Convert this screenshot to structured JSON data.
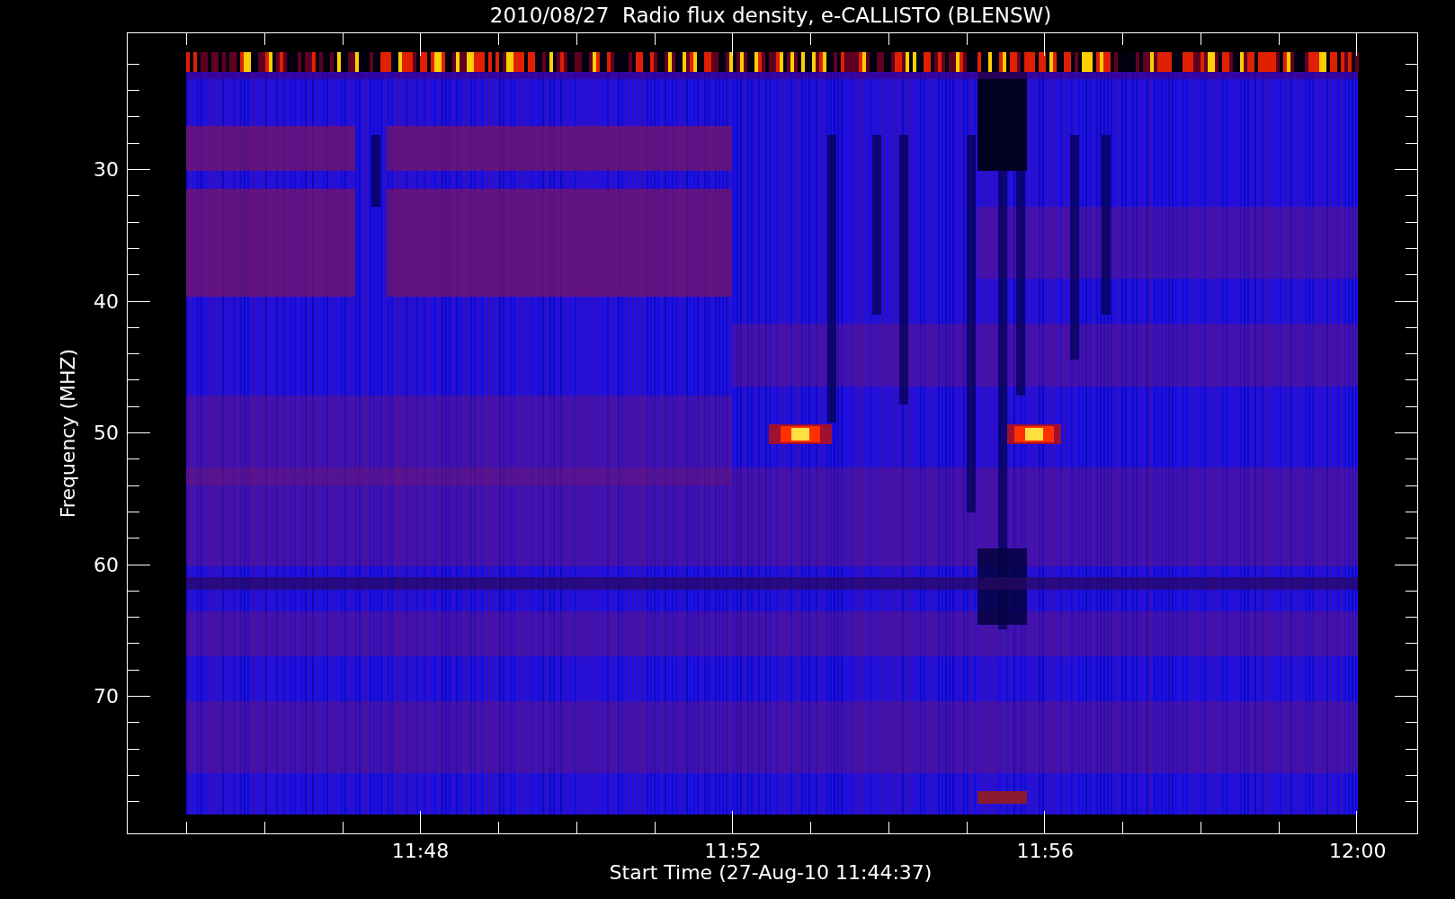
{
  "title": "2010/08/27  Radio flux density, e-CALLISTO (BLENSW)",
  "y_axis": {
    "label": "Frequency (MHZ)",
    "ticks": [
      "30",
      "40",
      "50",
      "60",
      "70"
    ]
  },
  "x_axis": {
    "label": "Start Time (27-Aug-10 11:44:37)",
    "ticks": [
      "11:48",
      "11:52",
      "11:56",
      "12:00"
    ]
  }
}
